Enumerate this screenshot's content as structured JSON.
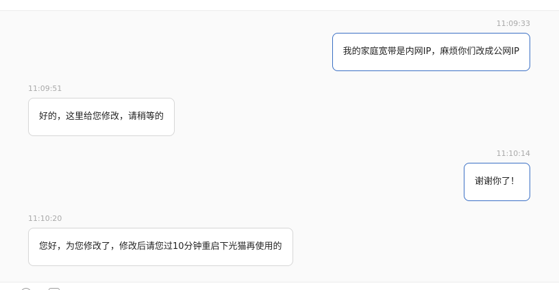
{
  "messages": [
    {
      "time": "11:09:33",
      "text": "我的家庭宽带是内网IP，麻烦你们改成公网IP",
      "side": "sent"
    },
    {
      "time": "11:09:51",
      "text": "好的，这里给您修改，请稍等的",
      "side": "received"
    },
    {
      "time": "11:10:14",
      "text": "谢谢你了！",
      "side": "sent"
    },
    {
      "time": "11:10:20",
      "text": "您好，为您修改了，修改后请您过10分钟重启下光猫再使用的",
      "side": "received"
    }
  ],
  "toolbar": {
    "icons": [
      "emoji-icon",
      "image-icon"
    ]
  },
  "colors": {
    "sent_border": "#3a6fc4",
    "received_border": "#d6d6d6",
    "timestamp": "#a9a9a9",
    "background": "#fafafa"
  }
}
